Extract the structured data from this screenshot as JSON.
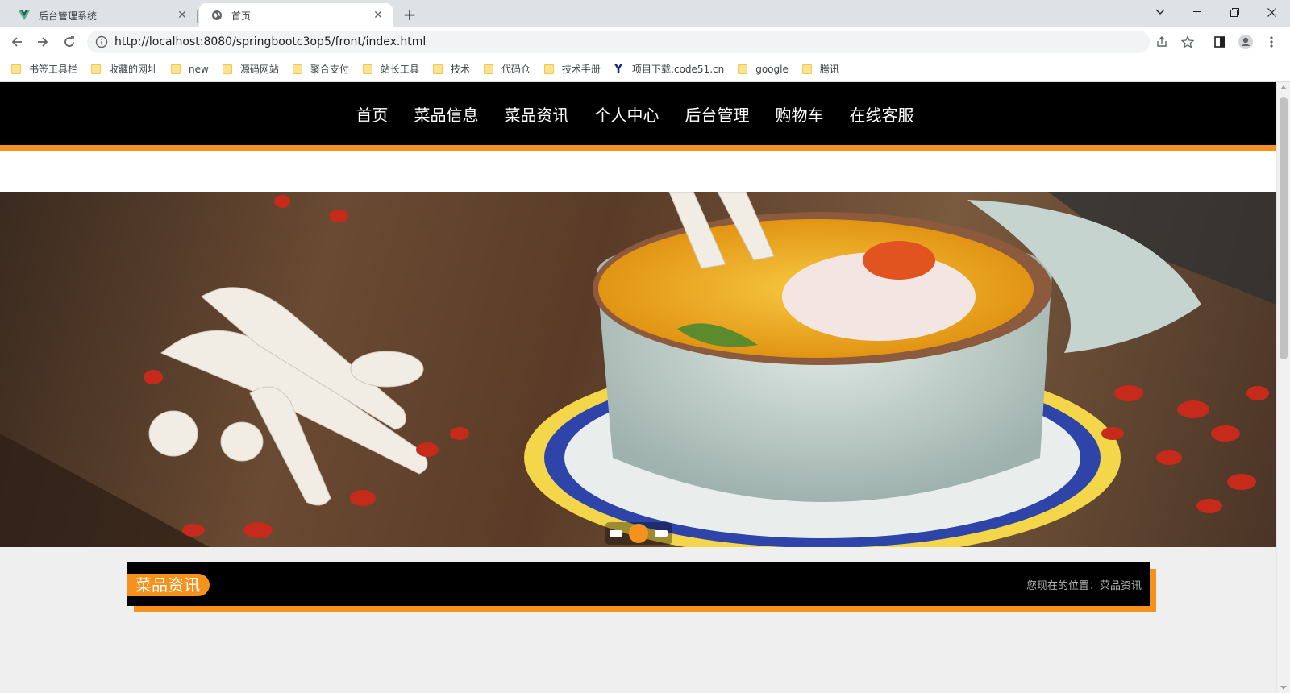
{
  "browser": {
    "tabs": [
      {
        "title": "后台管理系统",
        "icon": "vue-logo-icon",
        "active": false
      },
      {
        "title": "首页",
        "icon": "globe-icon",
        "active": true
      }
    ],
    "url": "http://localhost:8080/springbootc3op5/front/index.html",
    "bookmarks": [
      {
        "label": "书签工具栏",
        "icon": "folder-icon"
      },
      {
        "label": "收藏的网址",
        "icon": "folder-icon"
      },
      {
        "label": "new",
        "icon": "folder-icon"
      },
      {
        "label": "源码网站",
        "icon": "folder-icon"
      },
      {
        "label": "聚合支付",
        "icon": "folder-icon"
      },
      {
        "label": "站长工具",
        "icon": "folder-icon"
      },
      {
        "label": "技术",
        "icon": "folder-icon"
      },
      {
        "label": "代码仓",
        "icon": "folder-icon"
      },
      {
        "label": "技术手册",
        "icon": "folder-icon"
      },
      {
        "label": "项目下载:code51.cn",
        "icon": "y-logo-icon"
      },
      {
        "label": "google",
        "icon": "folder-icon"
      },
      {
        "label": "腾讯",
        "icon": "folder-icon"
      }
    ]
  },
  "site": {
    "nav": [
      "首页",
      "菜品信息",
      "菜品资讯",
      "个人中心",
      "后台管理",
      "购物车",
      "在线客服"
    ],
    "accent_color": "#f5921e",
    "banner": {
      "slide_count": 3,
      "active_index": 1
    },
    "section": {
      "title": "菜品资讯",
      "breadcrumb": "您现在的位置：菜品资讯"
    }
  }
}
